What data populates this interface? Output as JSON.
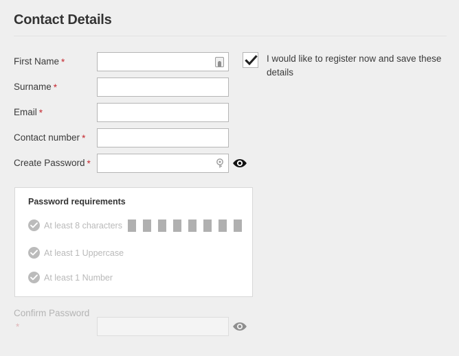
{
  "header": {
    "title": "Contact Details"
  },
  "form": {
    "fields": [
      {
        "label": "First Name",
        "required_mark": "*",
        "value": "",
        "placeholder": "",
        "icon": "contact-card-icon",
        "disabled": false
      },
      {
        "label": "Surname",
        "required_mark": "*",
        "value": "",
        "placeholder": "",
        "icon": "",
        "disabled": false
      },
      {
        "label": "Email",
        "required_mark": "*",
        "value": "",
        "placeholder": "",
        "icon": "",
        "disabled": false
      },
      {
        "label": "Contact number",
        "required_mark": "*",
        "value": "",
        "placeholder": "",
        "icon": "",
        "disabled": false
      },
      {
        "label": "Create Password",
        "required_mark": "*",
        "value": "",
        "placeholder": "",
        "icon": "key-icon",
        "disabled": false
      }
    ],
    "confirm_password": {
      "label": "Confirm Password",
      "required_mark": "*",
      "value": "",
      "placeholder": "",
      "disabled": true
    }
  },
  "register_checkbox": {
    "checked": true,
    "label": "I would like to register now and save these details"
  },
  "password_requirements": {
    "title": "Password requirements",
    "rules": [
      {
        "text": "At least 8 characters",
        "met": false
      },
      {
        "text": "At least 1 Uppercase",
        "met": false
      },
      {
        "text": "At least 1 Number",
        "met": false
      }
    ],
    "strength_blocks": 8
  },
  "icons": {
    "show_password": "eye-icon",
    "show_confirm_password": "eye-icon-disabled"
  },
  "colors": {
    "page_background": "#efefef",
    "panel_background": "#ffffff",
    "text": "#333333",
    "muted_text": "#b4b4b4",
    "required_asterisk": "#c4262e",
    "input_border": "#b5b5b5",
    "rule_icon": "#bbbbbb",
    "strength_block": "#b0b0b0"
  }
}
